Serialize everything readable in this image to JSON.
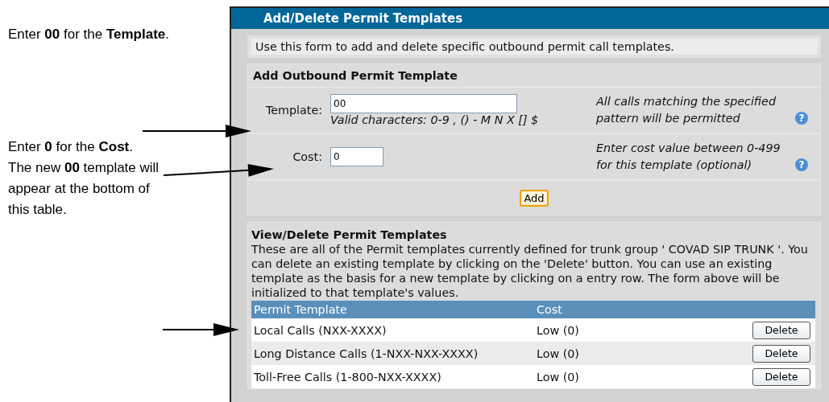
{
  "annotations": [
    {
      "text": "Enter **00** for the **Template**."
    },
    {
      "text": "Enter **0** for the **Cost**."
    },
    {
      "text": "The new **00** template will appear at the bottom of this table."
    }
  ],
  "panel": {
    "title": "Add/Delete Permit Templates",
    "intro": "Use this form to add and delete specific outbound permit call templates.",
    "add_section": {
      "heading": "Add Outbound Permit Template",
      "fields": [
        {
          "label": "Template:",
          "value": "00",
          "hint": "Valid characters: 0-9 , () - M N X [] $",
          "help": "All calls matching the specified pattern will be permitted",
          "help_icon": "?"
        },
        {
          "label": "Cost:",
          "value": "0",
          "help": "Enter cost value between 0-499 for this template (optional)",
          "help_icon": "?"
        }
      ],
      "button": "Add"
    },
    "view_section": {
      "heading": "View/Delete Permit Templates",
      "description": "These are all of the Permit templates currently defined for trunk group ' COVAD SIP TRUNK '. You can delete an existing template by clicking on the 'Delete' button. You can use an existing template as the basis for a new template by clicking on a entry row. The form above will be initialized to that template's values.",
      "table": {
        "columns": [
          "Permit Template",
          "Cost"
        ],
        "rows": [
          {
            "template": "Local Calls (NXX-XXXX)",
            "cost": "Low (0)",
            "action": "Delete"
          },
          {
            "template": "Long Distance Calls (1-NXX-NXX-XXXX)",
            "cost": "Low (0)",
            "action": "Delete"
          },
          {
            "template": "Toll-Free Calls (1-800-NXX-XXXX)",
            "cost": "Low (0)",
            "action": "Delete"
          }
        ]
      }
    }
  }
}
